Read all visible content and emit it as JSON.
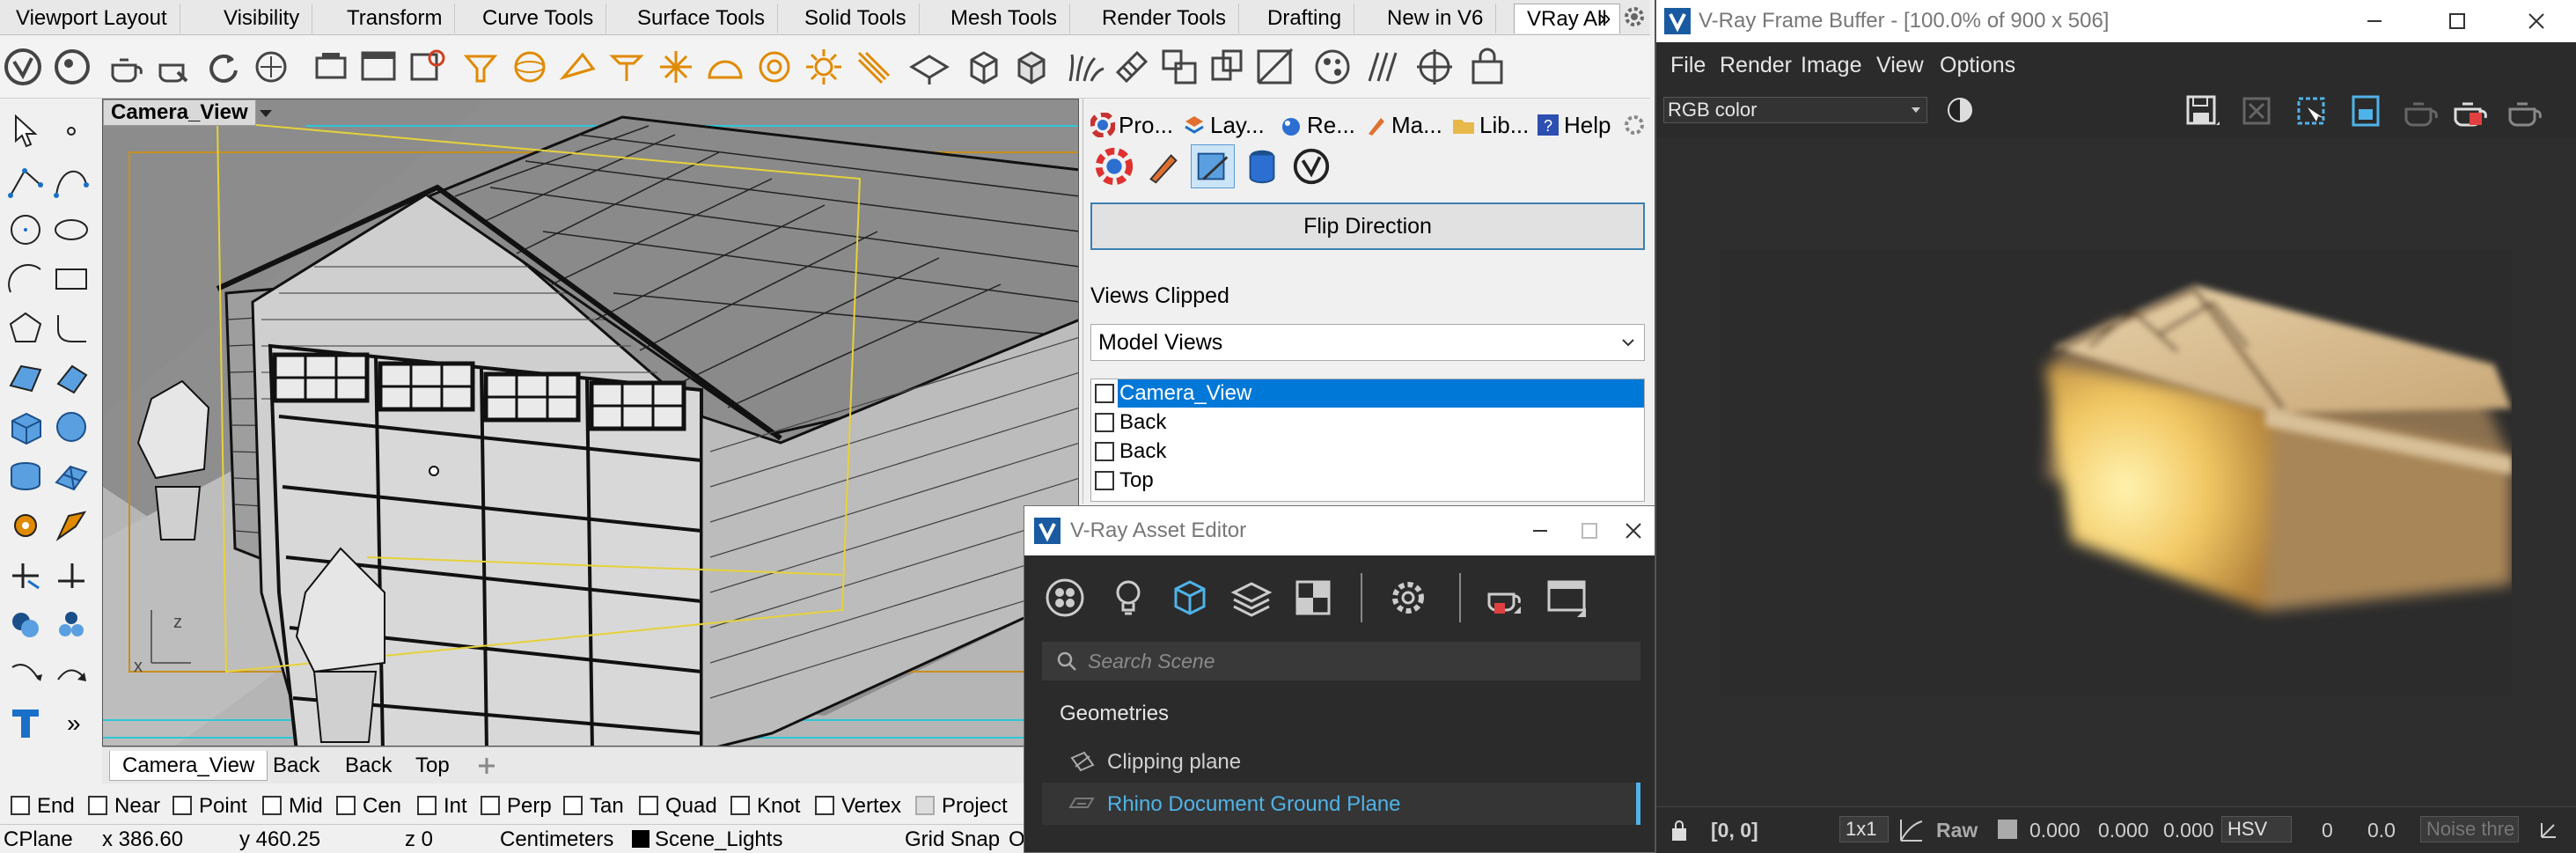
{
  "rhino": {
    "toolbar_tabs": [
      "Viewport Layout",
      "Visibility",
      "Transform",
      "Curve Tools",
      "Surface Tools",
      "Solid Tools",
      "Mesh Tools",
      "Render Tools",
      "Drafting",
      "New in V6",
      "VRay All"
    ],
    "toolbar_tabs_overflow": "»",
    "viewport": {
      "title": "Camera_View",
      "axis_x": "x",
      "axis_z": "z"
    },
    "view_tabs": [
      "Camera_View",
      "Back",
      "Back",
      "Top"
    ],
    "osnaps": [
      {
        "label": "End",
        "checked": false
      },
      {
        "label": "Near",
        "checked": false
      },
      {
        "label": "Point",
        "checked": false
      },
      {
        "label": "Mid",
        "checked": false
      },
      {
        "label": "Cen",
        "checked": false
      },
      {
        "label": "Int",
        "checked": false
      },
      {
        "label": "Perp",
        "checked": false
      },
      {
        "label": "Tan",
        "checked": false
      },
      {
        "label": "Quad",
        "checked": false
      },
      {
        "label": "Knot",
        "checked": false
      },
      {
        "label": "Vertex",
        "checked": false
      },
      {
        "label": "Project",
        "checked": false
      }
    ],
    "status": {
      "cplane": "CPlane",
      "x": "x 386.60",
      "y": "y 460.25",
      "z": "z 0",
      "units": "Centimeters",
      "layer": "Scene_Lights",
      "grid_snap": "Grid Snap",
      "ortho": "O"
    },
    "panel": {
      "tabs": [
        "Pro...",
        "Lay...",
        "Re...",
        "Ma...",
        "Lib...",
        "Help"
      ],
      "flip_button": "Flip Direction",
      "views_clipped_label": "Views Clipped",
      "model_views": "Model Views",
      "views": [
        {
          "label": "Camera_View",
          "selected": true
        },
        {
          "label": "Back",
          "selected": false
        },
        {
          "label": "Back",
          "selected": false
        },
        {
          "label": "Top",
          "selected": false
        }
      ]
    },
    "left_tools_more": "»"
  },
  "asset_editor": {
    "title": "V-Ray Asset Editor",
    "search_placeholder": "Search Scene",
    "section": "Geometries",
    "items": [
      {
        "label": "Clipping plane",
        "selected": false
      },
      {
        "label": "Rhino Document Ground Plane",
        "selected": true
      }
    ],
    "accent": "#4fb3e8"
  },
  "vfb": {
    "title": "V-Ray Frame Buffer - [100.0% of 900 x 506]",
    "menu": [
      "File",
      "Render",
      "Image",
      "View",
      "Options"
    ],
    "channel": "RGB color",
    "status": {
      "coords": "[0, 0]",
      "zoom": "1x1",
      "mode": "Raw",
      "r": "0.000",
      "g": "0.000",
      "b": "0.000",
      "color_space": "HSV",
      "h": "0",
      "v": "0.0",
      "noise": "Noise thre"
    }
  }
}
